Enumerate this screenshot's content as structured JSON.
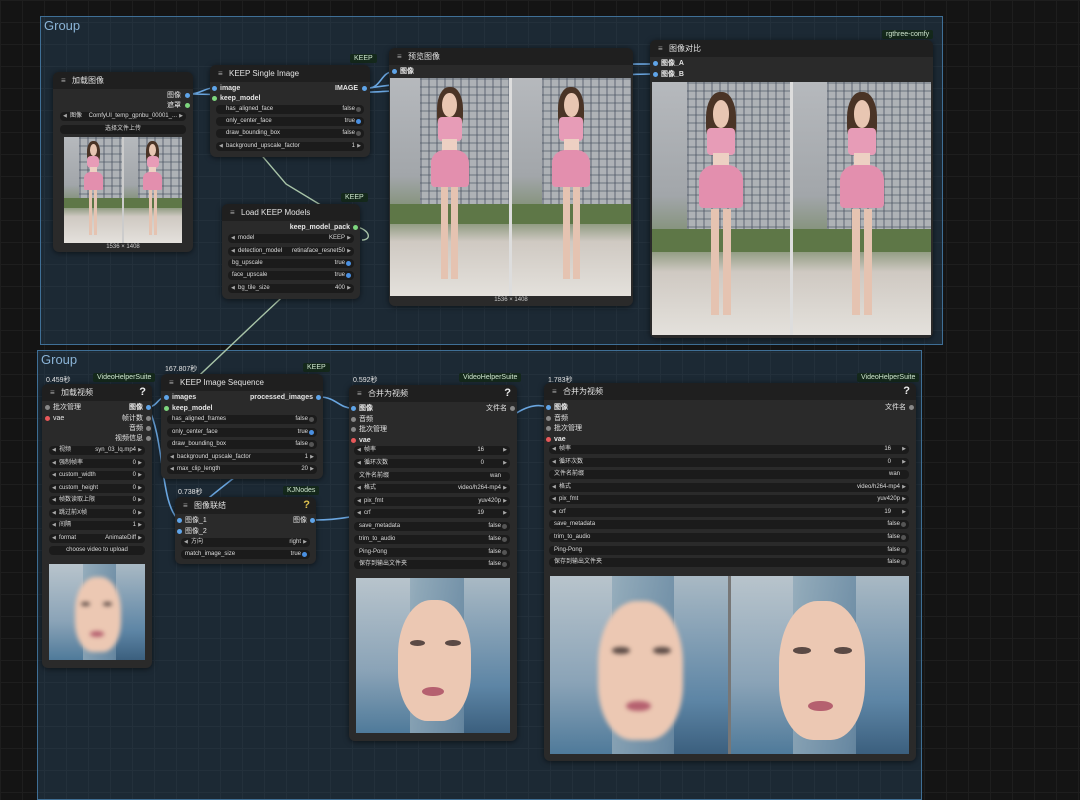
{
  "groups": [
    {
      "title": "Group"
    },
    {
      "title": "Group"
    }
  ],
  "badges": {
    "rgthree": "rgthree-comfy",
    "keep": "KEEP",
    "vhs": "VideoHelperSuite",
    "kj": "KJNodes"
  },
  "colors": {
    "image_port": "#5fa4e8",
    "green_port": "#7ed67e",
    "red_port": "#e8585a",
    "toggle_on": "#4a90e2"
  },
  "load_image": {
    "title": "加载图像",
    "out_image": "图像",
    "out_mask": "遮罩",
    "image_label": "图像",
    "image_value": "ComfyUI_temp_gpnbu_00001_...",
    "upload": "选择文件上传",
    "dims": "1536 × 1408"
  },
  "keep_single": {
    "title": "KEEP Single Image",
    "in_image": "image",
    "in_model": "keep_model",
    "out": "IMAGE",
    "widgets": [
      {
        "label": "has_aligned_face",
        "value": "false"
      },
      {
        "label": "only_center_face",
        "value": "true"
      },
      {
        "label": "draw_bounding_box",
        "value": "false"
      },
      {
        "label": "background_upscale_factor",
        "value": "1"
      }
    ]
  },
  "load_models": {
    "title": "Load KEEP Models",
    "out": "keep_model_pack",
    "widgets": [
      {
        "label": "model",
        "value": "KEEP"
      },
      {
        "label": "detection_model",
        "value": "retinaface_resnet50"
      },
      {
        "label": "bg_upscale",
        "value": "true"
      },
      {
        "label": "face_upscale",
        "value": "true"
      },
      {
        "label": "bg_tile_size",
        "value": "400"
      }
    ]
  },
  "preview": {
    "title": "预览图像",
    "in": "图像",
    "dims": "1536 × 1408"
  },
  "compare": {
    "title": "图像对比",
    "in_a": "图像_A",
    "in_b": "图像_B"
  },
  "load_video": {
    "title": "加载视频",
    "time": "0.459秒",
    "in_batch": "批次管理",
    "in_vae": "vae",
    "outs": [
      "图像",
      "帧计数",
      "音频",
      "视频信息"
    ],
    "widgets": [
      {
        "label": "视频",
        "value": "syn_03_lq.mp4"
      },
      {
        "label": "强制帧率",
        "value": "0"
      },
      {
        "label": "custom_width",
        "value": "0"
      },
      {
        "label": "custom_height",
        "value": "0"
      },
      {
        "label": "帧数读取上限",
        "value": "0"
      },
      {
        "label": "跳过前X帧",
        "value": "0"
      },
      {
        "label": "间隔",
        "value": "1"
      },
      {
        "label": "format",
        "value": "AnimateDiff"
      }
    ],
    "upload": "choose video to upload"
  },
  "keep_seq": {
    "title": "KEEP Image Sequence",
    "time": "167.807秒",
    "in_images": "images",
    "in_model": "keep_model",
    "out": "processed_images",
    "widgets": [
      {
        "label": "has_aligned_frames",
        "value": "false"
      },
      {
        "label": "only_center_face",
        "value": "true"
      },
      {
        "label": "draw_bounding_box",
        "value": "false"
      },
      {
        "label": "background_upscale_factor",
        "value": "1"
      },
      {
        "label": "max_clip_length",
        "value": "20"
      }
    ]
  },
  "concat": {
    "title": "图像联结",
    "time": "0.738秒",
    "in1": "图像_1",
    "in2": "图像_2",
    "out": "图像",
    "widgets": [
      {
        "label": "方向",
        "value": "right"
      },
      {
        "label": "match_image_size",
        "value": "true"
      }
    ]
  },
  "combine1": {
    "title": "合并为视频",
    "time": "0.592秒",
    "ins": [
      "图像",
      "音频",
      "批次管理",
      "vae"
    ],
    "out": "文件名",
    "widgets": [
      {
        "label": "帧率",
        "value": "16"
      },
      {
        "label": "循环次数",
        "value": "0"
      },
      {
        "label": "文件名前缀",
        "value": "wan"
      },
      {
        "label": "格式",
        "value": "video/h264-mp4"
      },
      {
        "label": "pix_fmt",
        "value": "yuv420p"
      },
      {
        "label": "crf",
        "value": "19"
      },
      {
        "label": "save_metadata",
        "value": "false"
      },
      {
        "label": "trim_to_audio",
        "value": "false"
      },
      {
        "label": "Ping-Pong",
        "value": "false"
      },
      {
        "label": "保存到输出文件夹",
        "value": "false"
      }
    ]
  },
  "combine2": {
    "title": "合并为视频",
    "time": "1.783秒",
    "ins": [
      "图像",
      "音频",
      "批次管理",
      "vae"
    ],
    "out": "文件名",
    "widgets": [
      {
        "label": "帧率",
        "value": "16"
      },
      {
        "label": "循环次数",
        "value": "0"
      },
      {
        "label": "文件名前缀",
        "value": "wan"
      },
      {
        "label": "格式",
        "value": "video/h264-mp4"
      },
      {
        "label": "pix_fmt",
        "value": "yuv420p"
      },
      {
        "label": "crf",
        "value": "19"
      },
      {
        "label": "save_metadata",
        "value": "false"
      },
      {
        "label": "trim_to_audio",
        "value": "false"
      },
      {
        "label": "Ping-Pong",
        "value": "false"
      },
      {
        "label": "保存到输出文件夹",
        "value": "false"
      }
    ]
  }
}
